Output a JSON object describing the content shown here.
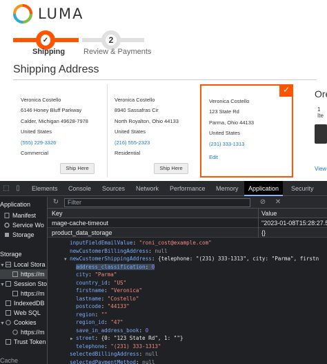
{
  "store": {
    "brand": "LUMA",
    "steps": [
      {
        "label": "Shipping",
        "number": "✓"
      },
      {
        "label": "Review & Payments",
        "number": "2"
      }
    ],
    "section_title": "Shipping Address",
    "addresses": [
      {
        "name": "Veronica Costello",
        "street": "6146 Honey Bluff Parkway",
        "city": "Calder, Michigan 49628-7978",
        "country": "United States",
        "phone": "(555) 229-3326",
        "type": "Commercial",
        "button": "Ship Here"
      },
      {
        "name": "Veronica Costello",
        "street": "8940 Sassafras Cir",
        "city": "North Royalton, Ohio 44133",
        "country": "United States",
        "phone": "(216) 555-2323",
        "type": "Residential",
        "button": "Ship Here"
      },
      {
        "name": "Veronica Costello",
        "street": "123 State Rd",
        "city": "Parma, Ohio 44133",
        "country": "United States",
        "phone": "(231) 333-1313",
        "edit": "Edit"
      }
    ],
    "summary": {
      "title": "Ore",
      "items": "1 Ite",
      "link": "View"
    }
  },
  "devtools": {
    "tabs": [
      "Elements",
      "Console",
      "Sources",
      "Network",
      "Performance",
      "Memory",
      "Application",
      "Security"
    ],
    "active_tab": "Application",
    "sidebar": {
      "app_header": "Application",
      "manifest": "Manifest",
      "service_workers": "Service Wo",
      "storage": "Storage",
      "storage_header": "Storage",
      "local_storage": "Local Stora",
      "local_storage_child": "https://m",
      "session_storage": "Session Sto",
      "session_storage_child": "https://m",
      "indexeddb": "IndexedDB",
      "websql": "Web SQL",
      "cookies": "Cookies",
      "cookies_child": "https://m",
      "trust_tokens": "Trust Token",
      "cache_header": "Cache"
    },
    "filter_placeholder": "Filter",
    "columns": {
      "key": "Key",
      "value": "Value"
    },
    "rows": [
      {
        "key": "mage-cache-timeout",
        "value": "\"2023-01-08T15:28:27.5"
      },
      {
        "key": "product_data_storage",
        "value": "{}"
      }
    ],
    "tree": [
      {
        "indent": 0,
        "key": "inputFieldEmailValue",
        "value": "\"roni_cost@example.com\"",
        "vtype": "s"
      },
      {
        "indent": 0,
        "key": "newCustomerBillingAddress",
        "value": "null",
        "vtype": "n"
      },
      {
        "indent": 0,
        "arrow": "▼",
        "key": "newCustomerShippingAddress",
        "value": "{telephone: \"(231) 333-1313\", city: \"Parma\", firstn",
        "vtype": "p"
      },
      {
        "indent": 1,
        "key": "address_classification",
        "value": "0",
        "vtype": "num",
        "highlight": true
      },
      {
        "indent": 1,
        "key": "city",
        "value": "\"Parma\"",
        "vtype": "s"
      },
      {
        "indent": 1,
        "key": "country_id",
        "value": "\"US\"",
        "vtype": "s"
      },
      {
        "indent": 1,
        "key": "firstname",
        "value": "\"Veronica\"",
        "vtype": "s"
      },
      {
        "indent": 1,
        "key": "lastname",
        "value": "\"Costello\"",
        "vtype": "s"
      },
      {
        "indent": 1,
        "key": "postcode",
        "value": "\"44133\"",
        "vtype": "s"
      },
      {
        "indent": 1,
        "key": "region",
        "value": "\"\"",
        "vtype": "s"
      },
      {
        "indent": 1,
        "key": "region_id",
        "value": "\"47\"",
        "vtype": "s"
      },
      {
        "indent": 1,
        "key": "save_in_address_book",
        "value": "0",
        "vtype": "num"
      },
      {
        "indent": 1,
        "arrow": "▶",
        "key": "street",
        "value": "{0: \"123 State Rd\", 1: \"\"}",
        "vtype": "p"
      },
      {
        "indent": 1,
        "key": "telephone",
        "value": "\"(231) 333-1313\"",
        "vtype": "s"
      },
      {
        "indent": 0,
        "key": "selectedBillingAddress",
        "value": "null",
        "vtype": "n"
      },
      {
        "indent": 0,
        "key": "selectedPaymentMethod",
        "value": "null",
        "vtype": "n"
      }
    ]
  },
  "colors": {
    "accent": "#ff5501",
    "link": "#1979c3",
    "devtools_bg": "#202124"
  }
}
